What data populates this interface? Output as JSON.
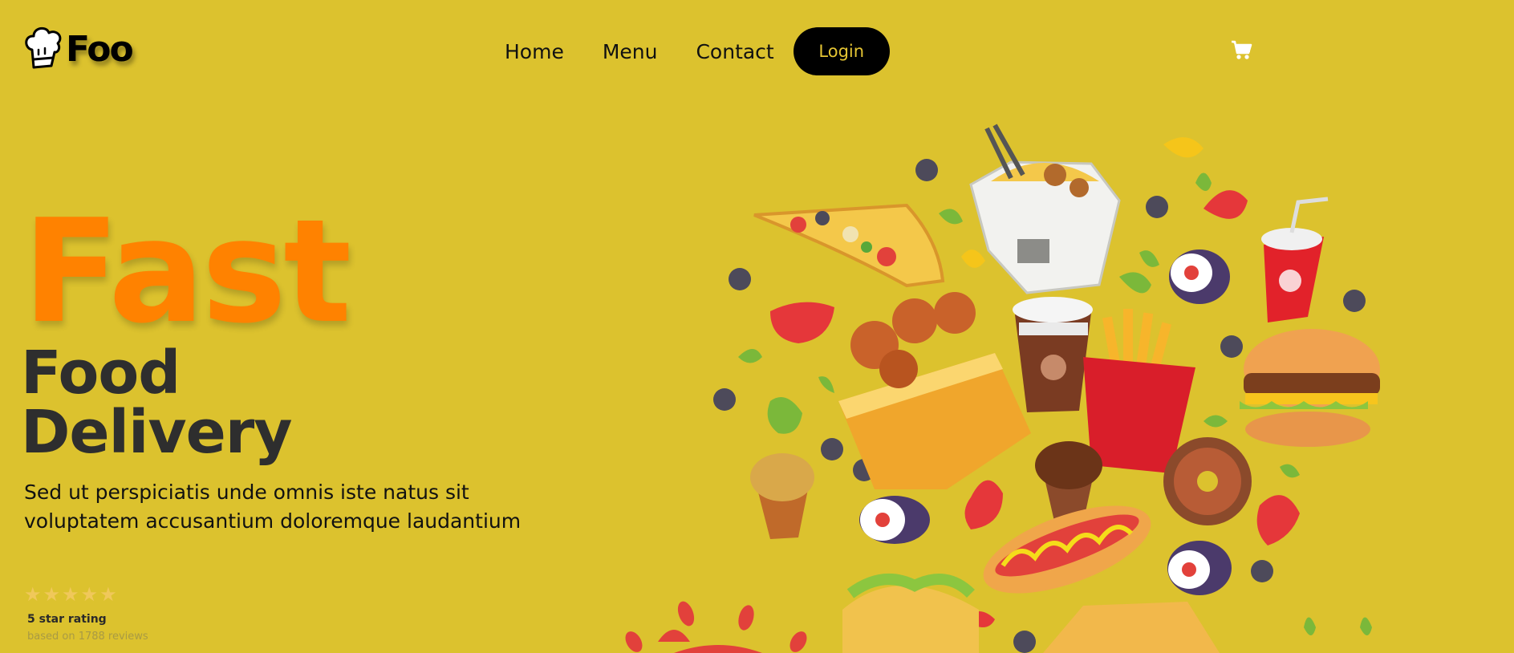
{
  "brand": {
    "name": "Foo",
    "logo_icon": "chef-hat-icon"
  },
  "nav": {
    "items": [
      {
        "label": "Home"
      },
      {
        "label": "Menu"
      },
      {
        "label": "Contact"
      }
    ],
    "login_label": "Login",
    "cart_icon": "cart-icon"
  },
  "hero": {
    "title_line1": "Fast",
    "title_line2": "Food",
    "title_line3": "Delivery",
    "description": "Sed ut perspiciatis unde omnis iste natus sit voluptatem accusantium doloremque laudantium"
  },
  "rating": {
    "stars": 5,
    "label": "5 star rating",
    "subtext": "based on 1788 reviews"
  },
  "colors": {
    "background": "#dcc22e",
    "accent": "#ff8200",
    "dark": "#2e2e2e",
    "button_text": "#e5c534"
  }
}
